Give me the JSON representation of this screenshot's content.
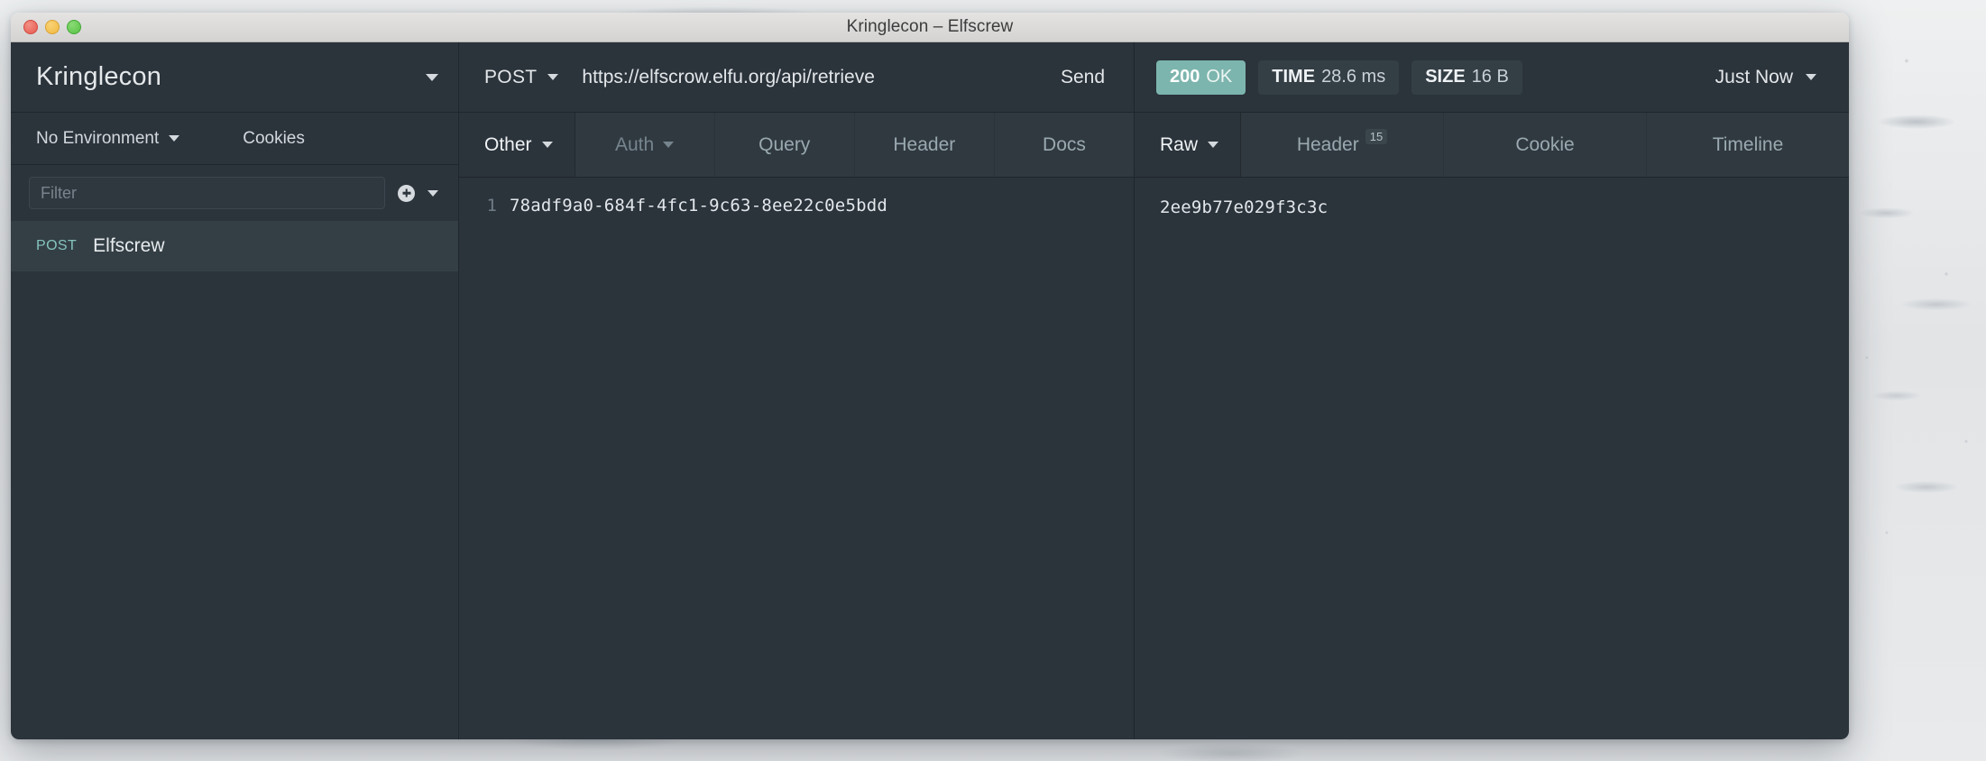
{
  "window": {
    "title": "Kringlecon – Elfscrew",
    "controls": {
      "close": "close-button",
      "minimize": "minimize-button",
      "zoom": "zoom-button"
    }
  },
  "sidebar": {
    "workspace": "Kringlecon",
    "environment": "No Environment",
    "cookies_label": "Cookies",
    "filter_placeholder": "Filter",
    "filter_value": "",
    "add_label": "+",
    "requests": [
      {
        "method": "POST",
        "name": "Elfscrew",
        "selected": true
      }
    ]
  },
  "request": {
    "method": "POST",
    "url": "https://elfscrow.elfu.org/api/retrieve",
    "send_label": "Send",
    "body_type": "Other",
    "tabs": [
      {
        "label": "Auth",
        "dimmed": true,
        "has_caret": true
      },
      {
        "label": "Query",
        "dimmed": false,
        "has_caret": false
      },
      {
        "label": "Header",
        "dimmed": false,
        "has_caret": false
      },
      {
        "label": "Docs",
        "dimmed": false,
        "has_caret": false
      }
    ],
    "body_lines": [
      {
        "number": "1",
        "text": "78adf9a0-684f-4fc1-9c63-8ee22c0e5bdd"
      }
    ]
  },
  "response": {
    "status_code": "200",
    "status_text": "OK",
    "time_key": "TIME",
    "time_value": "28.6 ms",
    "size_key": "SIZE",
    "size_value": "16 B",
    "history_label": "Just Now",
    "view_mode": "Raw",
    "tabs": [
      {
        "label": "Header",
        "badge": "15"
      },
      {
        "label": "Cookie",
        "badge": ""
      },
      {
        "label": "Timeline",
        "badge": ""
      }
    ],
    "body": "2ee9b77e029f3c3c"
  },
  "colors": {
    "app_background": "#2b333b",
    "panel_divider": "#1f262c",
    "accent_teal": "#7cb5ad",
    "method_teal": "#84c3bd",
    "selected_row": "#343f45",
    "tab_strip": "#303940",
    "text_primary": "#e4e8ea",
    "text_muted": "#9aa9b0",
    "titlebar": "#d4d3d2",
    "light_red": "#e6594d",
    "light_yellow": "#f0b93e",
    "light_green": "#56c244"
  }
}
